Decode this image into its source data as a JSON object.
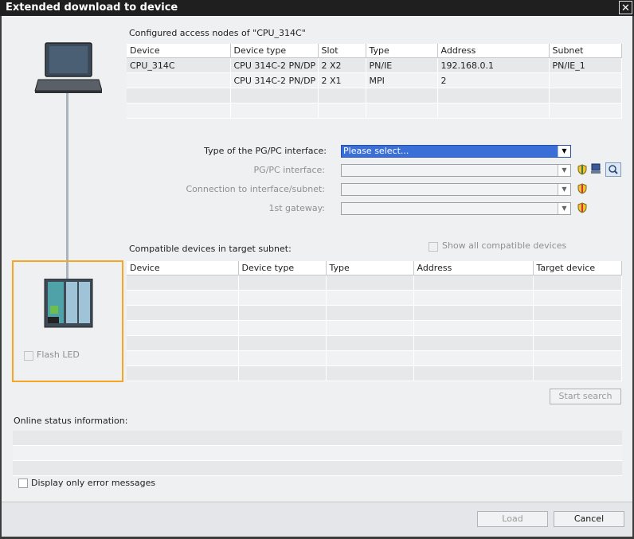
{
  "window": {
    "title": "Extended download to device",
    "close_glyph": "✕"
  },
  "configured": {
    "heading": "Configured access nodes of \"CPU_314C\"",
    "columns": [
      "Device",
      "Device type",
      "Slot",
      "Type",
      "Address",
      "Subnet"
    ],
    "rows": [
      [
        "CPU_314C",
        "CPU 314C-2 PN/DP",
        "2 X2",
        "PN/IE",
        "192.168.0.1",
        "PN/IE_1"
      ],
      [
        "",
        "CPU 314C-2 PN/DP",
        "2 X1",
        "MPI",
        "2",
        ""
      ],
      [
        "",
        "",
        "",
        "",
        "",
        ""
      ],
      [
        "",
        "",
        "",
        "",
        "",
        ""
      ]
    ]
  },
  "interface": {
    "type_label": "Type of the PG/PC interface:",
    "type_value": "Please select...",
    "pgpc_label": "PG/PC interface:",
    "connection_label": "Connection to interface/subnet:",
    "gateway_label": "1st gateway:"
  },
  "compatible": {
    "heading": "Compatible devices in target subnet:",
    "show_all_label": "Show all compatible devices",
    "columns": [
      "Device",
      "Device type",
      "Type",
      "Address",
      "Target device"
    ],
    "row_count": 7
  },
  "flash_led_label": "Flash LED",
  "start_search_label": "Start search",
  "online_status": {
    "label": "Online status information:"
  },
  "display_errors_label": "Display only error messages",
  "footer": {
    "load_label": "Load",
    "cancel_label": "Cancel"
  },
  "colors": {
    "highlight": "#f5a623",
    "selection": "#3a6fd8",
    "title_bar": "#1f1f1f"
  }
}
